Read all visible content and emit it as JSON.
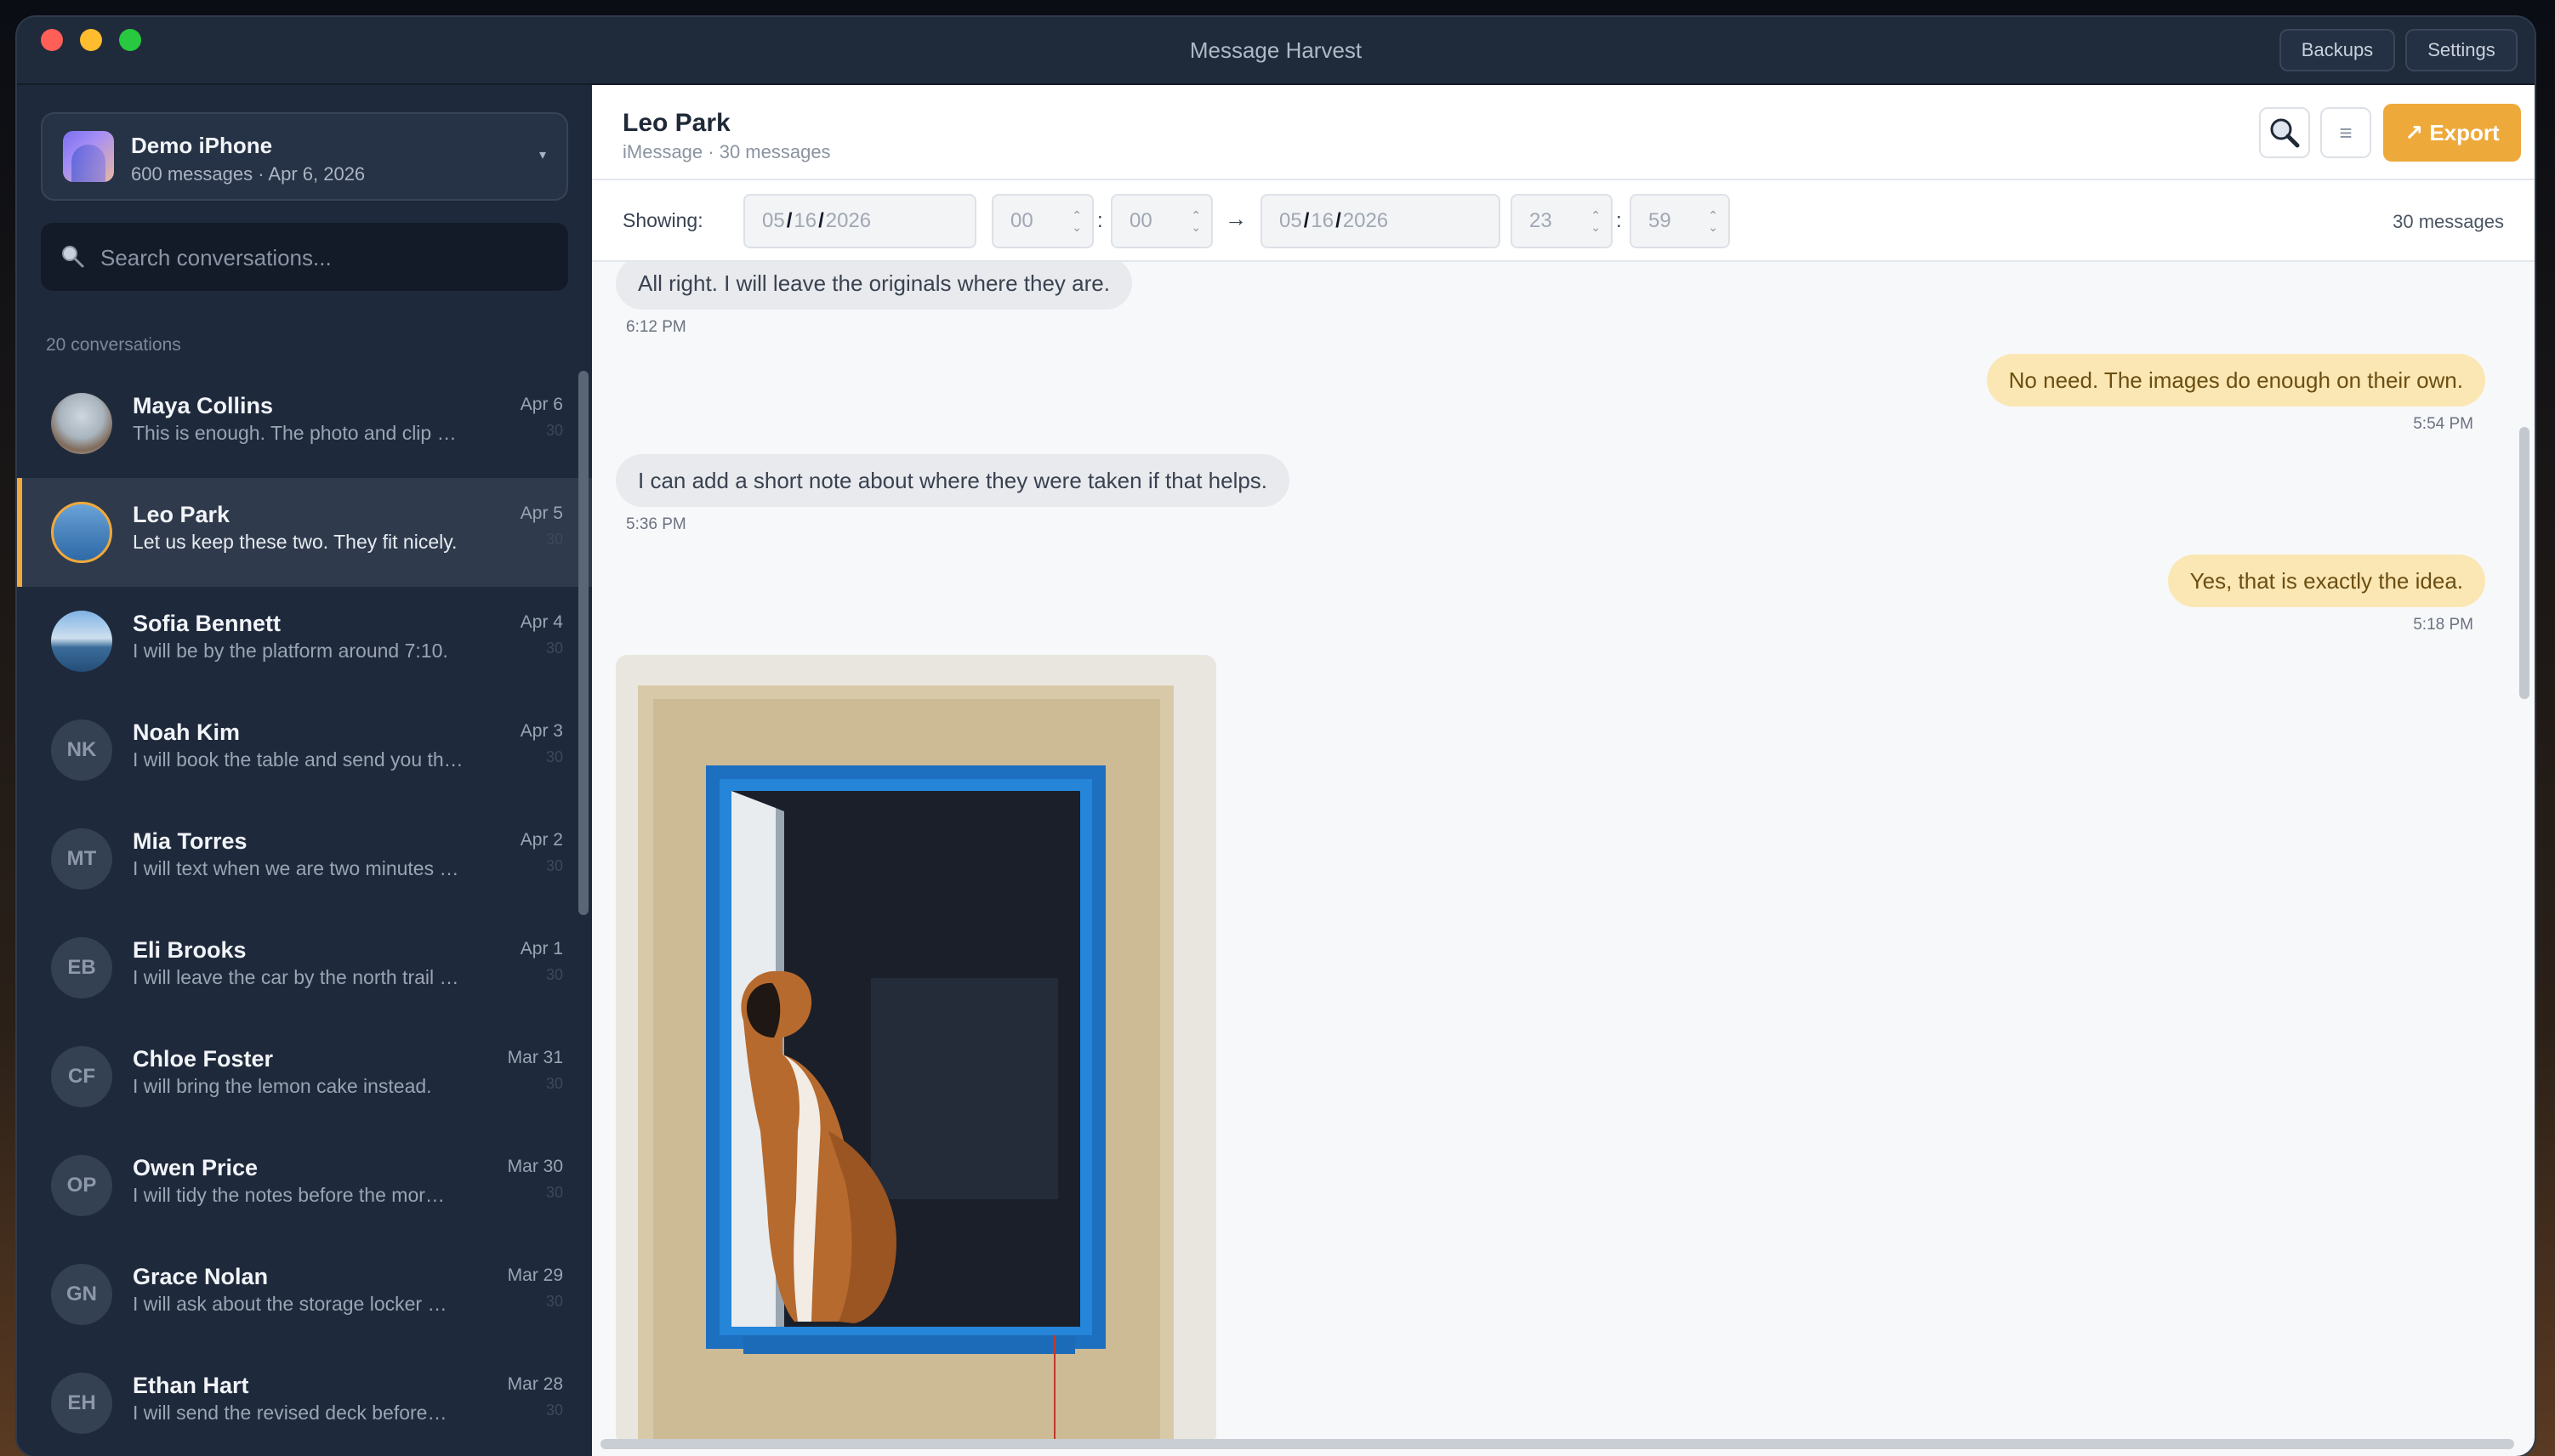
{
  "window": {
    "title": "Message Harvest",
    "backups_label": "Backups",
    "settings_label": "Settings"
  },
  "device": {
    "name": "Demo iPhone",
    "subtitle": "600 messages · Apr 6, 2026",
    "chevron": "▾"
  },
  "search": {
    "placeholder": "Search conversations..."
  },
  "sidebar": {
    "count_label": "20 conversations",
    "conversations": [
      {
        "name": "Maya Collins",
        "preview": "This is enough. The photo and clip …",
        "date": "Apr 6",
        "count": "30",
        "avatar": "photo"
      },
      {
        "name": "Leo Park",
        "preview": "Let us keep these two. They fit nicely.",
        "date": "Apr 5",
        "count": "30",
        "avatar": "photo",
        "selected": true
      },
      {
        "name": "Sofia Bennett",
        "preview": "I will be by the platform around 7:10.",
        "date": "Apr 4",
        "count": "30",
        "avatar": "photo"
      },
      {
        "name": "Noah Kim",
        "preview": "I will book the table and send you th…",
        "date": "Apr 3",
        "count": "30",
        "initials": "NK"
      },
      {
        "name": "Mia Torres",
        "preview": "I will text when we are two minutes …",
        "date": "Apr 2",
        "count": "30",
        "initials": "MT"
      },
      {
        "name": "Eli Brooks",
        "preview": "I will leave the car by the north trail …",
        "date": "Apr 1",
        "count": "30",
        "initials": "EB"
      },
      {
        "name": "Chloe Foster",
        "preview": "I will bring the lemon cake instead.",
        "date": "Mar 31",
        "count": "30",
        "initials": "CF"
      },
      {
        "name": "Owen Price",
        "preview": "I will tidy the notes before the mor…",
        "date": "Mar 30",
        "count": "30",
        "initials": "OP"
      },
      {
        "name": "Grace Nolan",
        "preview": "I will ask about the storage locker …",
        "date": "Mar 29",
        "count": "30",
        "initials": "GN"
      },
      {
        "name": "Ethan Hart",
        "preview": "I will send the revised deck before…",
        "date": "Mar 28",
        "count": "30",
        "initials": "EH"
      }
    ]
  },
  "header": {
    "title": "Leo Park",
    "subtitle": "iMessage · 30 messages",
    "export_label": "↗ Export",
    "menu_glyph": "≡"
  },
  "filter": {
    "label": "Showing:",
    "from_month": "05",
    "from_day": "16",
    "from_year": "2026",
    "from_hour": "00",
    "from_minute": "00",
    "arrow": "→",
    "to_month": "05",
    "to_day": "16",
    "to_year": "2026",
    "to_hour": "23",
    "to_minute": "59",
    "count": "30 messages",
    "colon": ":",
    "slash": "/"
  },
  "messages": [
    {
      "text": "All right. I will leave the originals where they are.",
      "time": "6:12 PM",
      "dir": "in"
    },
    {
      "text": "No need. The images do enough on their own.",
      "time": "5:54 PM",
      "dir": "out"
    },
    {
      "text": "I can add a short note about where they were taken if that helps.",
      "time": "5:36 PM",
      "dir": "in"
    },
    {
      "text": "Yes, that is exactly the idea.",
      "time": "5:18 PM",
      "dir": "out"
    }
  ],
  "colors": {
    "accent": "#eea93b",
    "sidebar": "#1e293b",
    "outgoing": "#fbe7b4",
    "incoming": "#e8eaee"
  }
}
